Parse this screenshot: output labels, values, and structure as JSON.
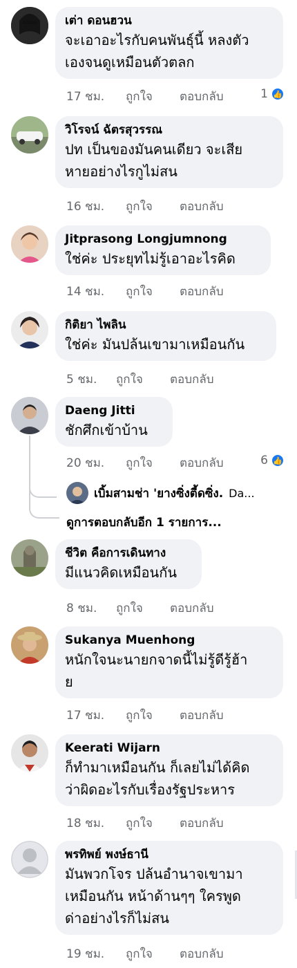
{
  "comments": [
    {
      "name": "เต่า ดอนฮวน",
      "lines": [
        "จะเอาอะไรกับคนพันธุ์นี้ หลงตัว",
        "เองจนดูเหมือนตัวตลก"
      ],
      "time": "17 ชม.",
      "like_label": "ถูกใจ",
      "reply_label": "ตอบกลับ",
      "reaction_count": "1",
      "avatar_color": "#3a3a3a"
    },
    {
      "name": "วิโรจน์ ฉัตรสุวรรณ",
      "lines": [
        "ปท เป็นของมันคนเดียว จะเสีย",
        "หายอย่างไรกูไม่สน"
      ],
      "time": "16 ชม.",
      "like_label": "ถูกใจ",
      "reply_label": "ตอบกลับ",
      "avatar_color": "#8aa07a"
    },
    {
      "name": "Jitprasong Longjumnong",
      "lines": [
        "ใช่ค่ะ ประยุทไม่รู้เอาอะไรคิด"
      ],
      "time": "14 ชม.",
      "like_label": "ถูกใจ",
      "reply_label": "ตอบกลับ",
      "avatar_color": "#c98a6a"
    },
    {
      "name": "กิติยา ไพลิน",
      "lines": [
        "ใช่ค่ะ มันปล้นเขามาเหมือนกัน"
      ],
      "time": "5 ชม.",
      "like_label": "ถูกใจ",
      "reply_label": "ตอบกลับ",
      "avatar_color": "#5a4a44"
    },
    {
      "name": "Daeng Jitti",
      "lines": [
        "ชักศึกเข้าบ้าน"
      ],
      "time": "20 ชม.",
      "like_label": "ถูกใจ",
      "reply_label": "ตอบกลับ",
      "reaction_count": "6",
      "avatar_color": "#4a4e58"
    },
    {
      "name": "ชีวิต คือการเดินทาง",
      "lines": [
        "มีแนวคิดเหมือนกัน"
      ],
      "time": "8 ชม.",
      "like_label": "ถูกใจ",
      "reply_label": "ตอบกลับ",
      "avatar_color": "#7d7a68"
    },
    {
      "name": "Sukanya Muenhong",
      "lines": [
        "หนักใจนะนายกจาดนี้ไม่รู้ดีรู้ฮ้า",
        "ย"
      ],
      "time": "17 ชม.",
      "like_label": "ถูกใจ",
      "reply_label": "ตอบกลับ",
      "avatar_color": "#b4543e"
    },
    {
      "name": "Keerati Wijarn",
      "lines": [
        "ก็ทำมาเหมือนกัน ก็เลยไม่ได้คิด",
        "ว่าผิดอะไรกับเรื่องรัฐประหาร"
      ],
      "time": "18 ชม.",
      "like_label": "ถูกใจ",
      "reply_label": "ตอบกลับ",
      "avatar_color": "#6b4236"
    },
    {
      "name": "พรทิพย์ พงษ์ธานี",
      "lines": [
        "มันพวกโจร ปล้นอำนาจเขามา",
        "เหมือนกัน หน้าด้านๆๆ ใครพูด",
        "ด่าอย่างไรก็ไม่สน"
      ],
      "time": "19 ชม.",
      "like_label": "ถูกใจ",
      "reply_label": "ตอบกลับ",
      "avatar_color": "#d6d9de"
    }
  ],
  "reply_thread": {
    "preview_name": "เบิ้มสามช่า 'ยางซิ่งตี้ดซิ่ง.",
    "preview_snippet": "Da...",
    "more_label": "ดูการตอบกลับอีก 1 รายการ..."
  },
  "colors": {
    "bubble": "#f0f2f5",
    "meta_text": "#65676b",
    "like_blue": "#1877f2"
  }
}
